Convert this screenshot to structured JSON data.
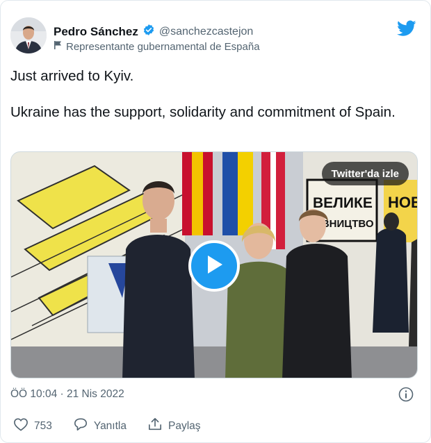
{
  "author": {
    "name": "Pedro Sánchez",
    "handle": "@sanchezcastejon",
    "label": "Representante gubernamental de España"
  },
  "tweet": {
    "lines": [
      "Just arrived to Kyiv.",
      "Ukraine has the support, solidarity and commitment of Spain."
    ]
  },
  "media": {
    "watch_button": "Twitter'da izle",
    "banner_text_1": "ВЕЛИКЕ",
    "banner_text_2": "ДІВНИЦТВО",
    "banner_side": "НОВ"
  },
  "meta": {
    "timestamp": "ÖÖ 10:04 · 21 Nis 2022"
  },
  "actions": {
    "like_count": "753",
    "reply_label": "Yanıtla",
    "share_label": "Paylaş"
  },
  "colors": {
    "accent": "#1d9bf0",
    "verified": "#1d9bf0",
    "muted": "#536471"
  },
  "icons": [
    "verified-badge-icon",
    "flag-icon",
    "twitter-bird-icon",
    "play-icon",
    "info-icon",
    "heart-icon",
    "reply-icon",
    "share-icon"
  ]
}
